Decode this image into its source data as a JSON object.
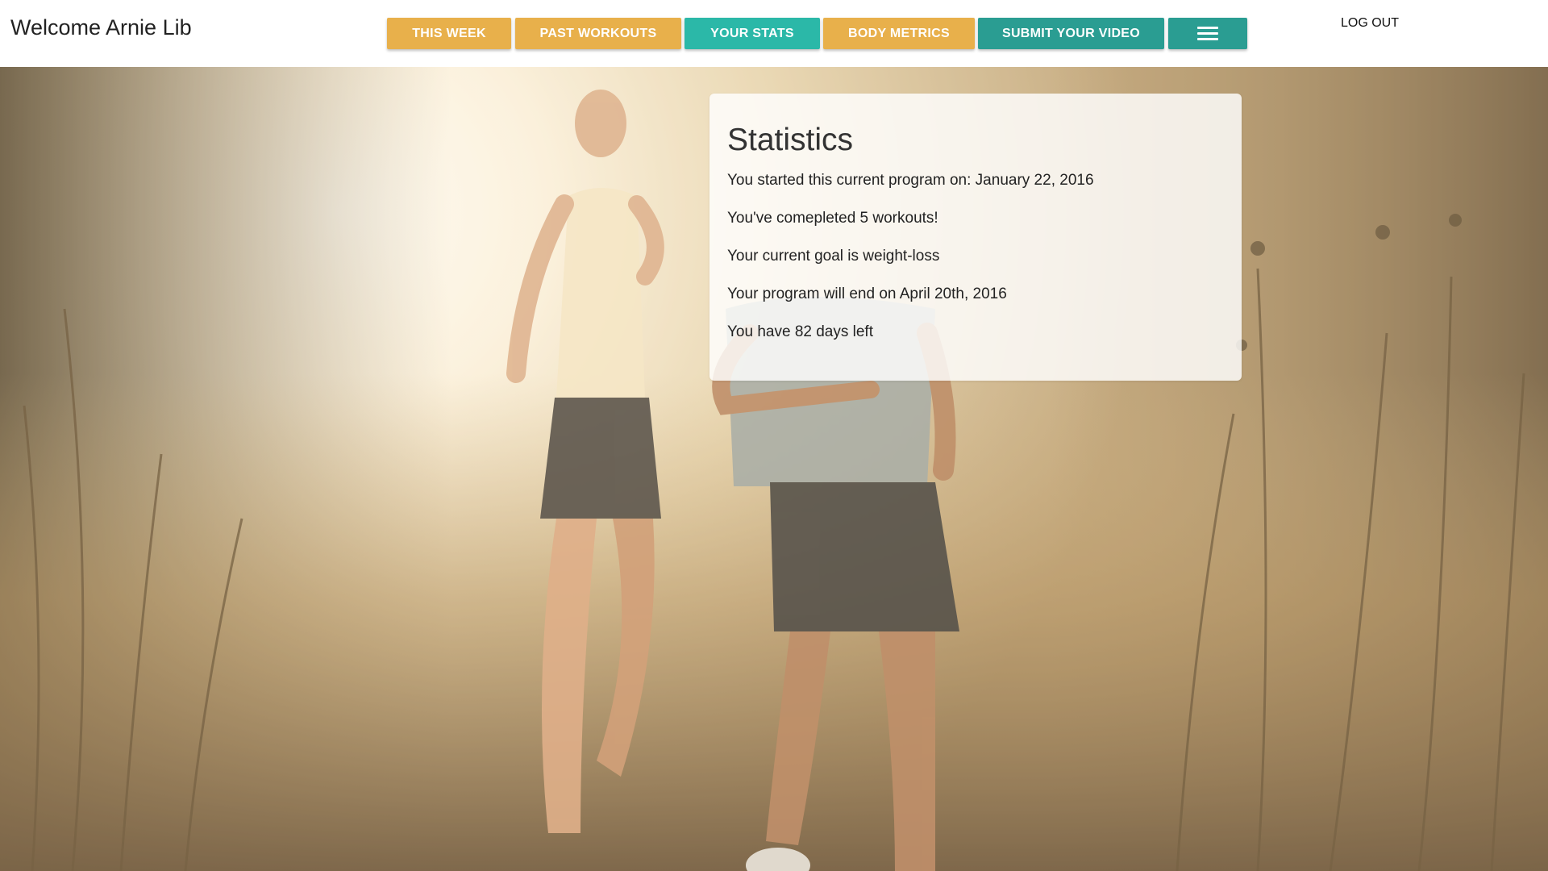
{
  "header": {
    "welcome": "Welcome Arnie Lib",
    "logout_label": "LOG OUT"
  },
  "nav": {
    "items": [
      {
        "label": "THIS WEEK",
        "color": "#e8b04b"
      },
      {
        "label": "PAST WORKOUTS",
        "color": "#e8b04b"
      },
      {
        "label": "YOUR STATS",
        "color": "#2bb8a8"
      },
      {
        "label": "BODY METRICS",
        "color": "#e8b04b"
      },
      {
        "label": "SUBMIT YOUR VIDEO",
        "color": "#2a9d92"
      }
    ],
    "menu_icon": "hamburger-icon",
    "menu_color": "#2a9d92"
  },
  "stats": {
    "title": "Statistics",
    "lines": [
      "You started this current program on: January 22, 2016",
      "You've comepleted 5 workouts!",
      "Your current goal is weight-loss",
      "Your program will end on April 20th, 2016",
      "You have 82 days left"
    ]
  },
  "hero": {
    "image": "two-runners-in-field-photo"
  }
}
